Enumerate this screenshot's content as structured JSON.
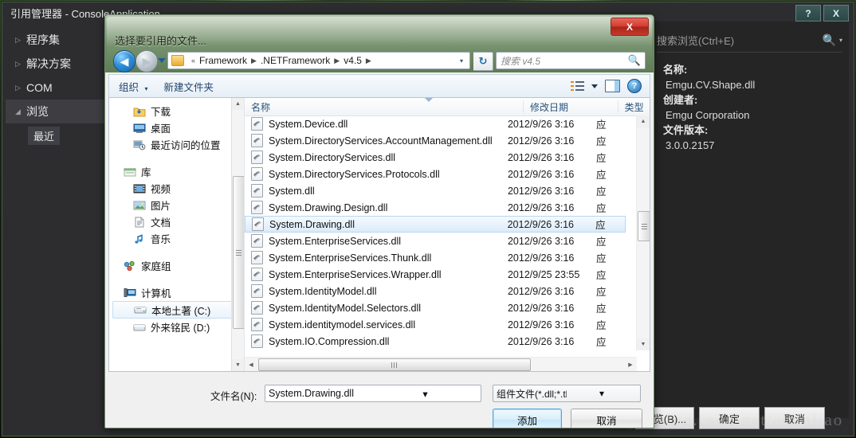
{
  "reference_manager": {
    "title": "引用管理器 - ConsoleApplication",
    "window_buttons": [
      {
        "name": "help",
        "label": "?"
      },
      {
        "name": "close",
        "label": "X"
      }
    ],
    "tree": [
      {
        "label": "程序集",
        "expander": "▷",
        "selected": false
      },
      {
        "label": "解决方案",
        "expander": "▷",
        "selected": false
      },
      {
        "label": "COM",
        "expander": "▷",
        "selected": false
      },
      {
        "label": "浏览",
        "expander": "◢",
        "selected": true
      }
    ],
    "sub_item": "最近",
    "search": {
      "placeholder": "搜索浏览(Ctrl+E)",
      "icon": "search-icon",
      "caret": "▾"
    },
    "details": [
      {
        "key": "名称:",
        "value": "Emgu.CV.Shape.dll"
      },
      {
        "key": "创建者:",
        "value": "Emgu Corporation"
      },
      {
        "key": "文件版本:",
        "value": "3.0.0.2157"
      }
    ],
    "footer_buttons": [
      {
        "name": "browse",
        "label": "浏览(B)..."
      },
      {
        "name": "ok",
        "label": "确定"
      },
      {
        "name": "cancel",
        "label": "取消"
      }
    ]
  },
  "watermark": "http://blog.csdn.net/akunliao",
  "file_dialog": {
    "title": "选择要引用的文件...",
    "close_label": "X",
    "nav": {
      "back_glyph": "◀",
      "forward_glyph": "▶",
      "history_caret": "▾",
      "breadcrumb_prefix": "«",
      "breadcrumbs": [
        "Framework",
        ".NETFramework",
        "v4.5"
      ],
      "separator": "▶",
      "address_dropdown": "▾",
      "refresh_glyph": "↻"
    },
    "search": {
      "placeholder": "搜索 v4.5",
      "icon": "search-icon"
    },
    "command_bar": {
      "organize": "组织",
      "organize_caret": "▾",
      "new_folder": "新建文件夹",
      "view_icon": "list-view-icon",
      "view_caret": "▾",
      "preview_icon": "preview-pane-icon",
      "help_icon": "help-icon"
    },
    "nav_pane": {
      "groups": [
        {
          "items": [
            {
              "label": "下载",
              "icon": "downloads-folder-icon",
              "indent": true,
              "selected": false
            },
            {
              "label": "桌面",
              "icon": "desktop-icon",
              "indent": true,
              "selected": false
            },
            {
              "label": "最近访问的位置",
              "icon": "recent-places-icon",
              "indent": true,
              "selected": false
            }
          ]
        },
        {
          "items": [
            {
              "label": "库",
              "icon": "library-icon",
              "indent": false,
              "selected": false
            },
            {
              "label": "视频",
              "icon": "videos-icon",
              "indent": true,
              "selected": false
            },
            {
              "label": "图片",
              "icon": "pictures-icon",
              "indent": true,
              "selected": false
            },
            {
              "label": "文档",
              "icon": "documents-icon",
              "indent": true,
              "selected": false
            },
            {
              "label": "音乐",
              "icon": "music-icon",
              "indent": true,
              "selected": false
            }
          ]
        },
        {
          "items": [
            {
              "label": "家庭组",
              "icon": "homegroup-icon",
              "indent": false,
              "selected": false
            }
          ]
        },
        {
          "items": [
            {
              "label": "计算机",
              "icon": "computer-icon",
              "indent": false,
              "selected": false
            },
            {
              "label": "本地土著 (C:)",
              "icon": "drive-icon",
              "indent": true,
              "selected": true
            },
            {
              "label": "外来铭民 (D:)",
              "icon": "drive-icon",
              "indent": true,
              "selected": false
            }
          ]
        }
      ]
    },
    "columns": [
      "名称",
      "修改日期",
      "类型"
    ],
    "files": [
      {
        "name": "System.Device.dll",
        "date": "2012/9/26 3:16",
        "type": "应",
        "selected": false
      },
      {
        "name": "System.DirectoryServices.AccountManagement.dll",
        "date": "2012/9/26 3:16",
        "type": "应",
        "selected": false
      },
      {
        "name": "System.DirectoryServices.dll",
        "date": "2012/9/26 3:16",
        "type": "应",
        "selected": false
      },
      {
        "name": "System.DirectoryServices.Protocols.dll",
        "date": "2012/9/26 3:16",
        "type": "应",
        "selected": false
      },
      {
        "name": "System.dll",
        "date": "2012/9/26 3:16",
        "type": "应",
        "selected": false
      },
      {
        "name": "System.Drawing.Design.dll",
        "date": "2012/9/26 3:16",
        "type": "应",
        "selected": false
      },
      {
        "name": "System.Drawing.dll",
        "date": "2012/9/26 3:16",
        "type": "应",
        "selected": true
      },
      {
        "name": "System.EnterpriseServices.dll",
        "date": "2012/9/26 3:16",
        "type": "应",
        "selected": false
      },
      {
        "name": "System.EnterpriseServices.Thunk.dll",
        "date": "2012/9/26 3:16",
        "type": "应",
        "selected": false
      },
      {
        "name": "System.EnterpriseServices.Wrapper.dll",
        "date": "2012/9/25 23:55",
        "type": "应",
        "selected": false
      },
      {
        "name": "System.IdentityModel.dll",
        "date": "2012/9/26 3:16",
        "type": "应",
        "selected": false
      },
      {
        "name": "System.IdentityModel.Selectors.dll",
        "date": "2012/9/26 3:16",
        "type": "应",
        "selected": false
      },
      {
        "name": "System.identitymodel.services.dll",
        "date": "2012/9/26 3:16",
        "type": "应",
        "selected": false
      },
      {
        "name": "System.IO.Compression.dll",
        "date": "2012/9/26 3:16",
        "type": "应",
        "selected": false
      }
    ],
    "form": {
      "filename_label": "文件名(N):",
      "filename_value": "System.Drawing.dll",
      "filetype_value": "组件文件(*.dll;*.tlb;*.olb;*.ocx;",
      "dropdown_caret": "▾",
      "add_label": "添加",
      "cancel_label": "取消"
    }
  }
}
